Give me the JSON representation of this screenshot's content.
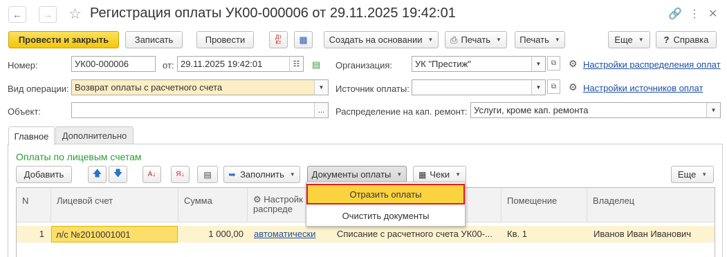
{
  "window": {
    "title": "Регистрация оплаты УК00-000006 от 29.11.2025 19:42:01"
  },
  "toolbar": {
    "post_close": "Провести и закрыть",
    "write": "Записать",
    "post": "Провести",
    "dt_kt_icon_label": "Дт Кт",
    "create_based": "Создать на основании",
    "print1": "Печать",
    "print2": "Печать",
    "more": "Еще",
    "help": "Справка",
    "help_icon": "?"
  },
  "form": {
    "number_label": "Номер:",
    "number_value": "УК00-000006",
    "date_label": "от:",
    "date_value": "29.11.2025 19:42:01",
    "operation_label": "Вид операции:",
    "operation_value": "Возврат оплаты с расчетного счета",
    "object_label": "Объект:",
    "object_value": "",
    "object_btn": "...",
    "org_label": "Организация:",
    "org_value": "УК \"Престиж\"",
    "source_label": "Источник оплаты:",
    "source_value": "",
    "distribution_label": "Распределение на кап. ремонт:",
    "distribution_value": "Услуги, кроме кап. ремонта",
    "link_distribution": "Настройки распределения оплат",
    "link_sources": "Настройки источников оплат"
  },
  "tabs": {
    "main": "Главное",
    "additional": "Дополнительно"
  },
  "section": {
    "title": "Оплаты по лицевым счетам",
    "add": "Добавить",
    "fill": "Заполнить",
    "payment_docs": "Документы оплаты",
    "checks": "Чеки",
    "more": "Еще"
  },
  "table": {
    "columns": {
      "n": "N",
      "account": "Лицевой счет",
      "sum": "Сумма",
      "settings_line1": "Настройк",
      "settings_line2": "распреде",
      "premises": "Помещение",
      "owner": "Владелец"
    },
    "rows": [
      {
        "n": "1",
        "account": "л/с №2010001001",
        "sum": "1 000,00",
        "settings": "автоматически",
        "doc": "Списание с расчетного счета УК00-...",
        "premises": "Кв. 1",
        "owner": "Иванов Иван Иванович"
      }
    ]
  },
  "popup": {
    "item1": "Отразить оплаты",
    "item2": "Очистить документы"
  },
  "colors": {
    "primary_button": "#f4c50b",
    "section_title": "#2a9c34",
    "link": "#1e4fa3",
    "row_highlight": "#fdf3cf",
    "popup_highlight": "#fbd33f",
    "popup_border": "#e31b1b"
  }
}
